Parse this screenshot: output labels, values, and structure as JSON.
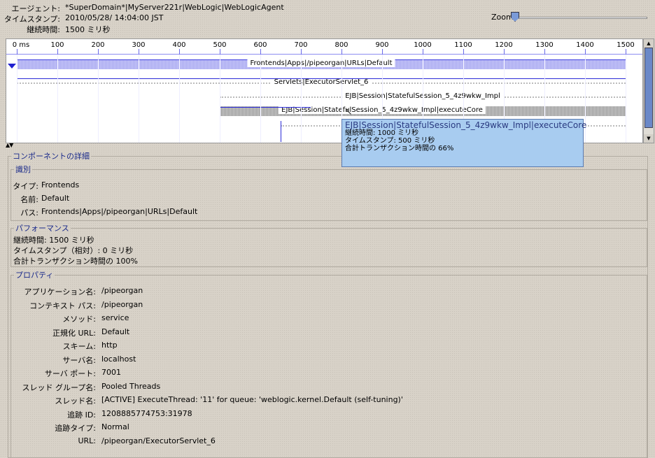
{
  "header": {
    "agent_label": "エージェント:",
    "agent": "*SuperDomain*|MyServer221r|WebLogic|WebLogicAgent",
    "timestamp_label": "タイムスタンプ:",
    "timestamp": "2010/05/28/ 14:04:00 JST",
    "duration_label": "継続時間:",
    "duration": "1500 ミリ秒",
    "zoom_label": "Zoom",
    "zoom_value": 0
  },
  "timeline": {
    "ticks": [
      "0 ms",
      "100",
      "200",
      "300",
      "400",
      "500",
      "600",
      "700",
      "800",
      "900",
      "1000",
      "1100",
      "1200",
      "1300",
      "1400",
      "1500"
    ],
    "rows": [
      {
        "label": "Frontends|Apps|/pipeorgan|URLs|Default",
        "start": 0,
        "duration": 1500
      },
      {
        "label": "Servlets|ExecutorServlet_6",
        "start": 0,
        "duration": 1500
      },
      {
        "label": "EJB|Session|StatefulSession_5_4z9wkw_Impl",
        "start": 500,
        "duration": 1000
      },
      {
        "label": "EJB|Session|StatefulSession_5_4z9wkw_Impl|executeCore",
        "start": 500,
        "duration": 1000
      },
      {
        "label": "EJB|Session|StatefulSession_5_4z9wkw_Impl",
        "start": 650,
        "duration": 850
      }
    ]
  },
  "tooltip": {
    "title": "EJB|Session|StatefulSession_5_4z9wkw_Impl|executeCore",
    "line1": "継続時間: 1000 ミリ秒",
    "line2": "タイムスタンプ: 500 ミリ秒",
    "line3": "合計トランザクション時間の 66%"
  },
  "details": {
    "title": "コンポーネントの詳細",
    "identity": {
      "title": "識別",
      "type_label": "タイプ:",
      "type": "Frontends",
      "name_label": "名前:",
      "name": "Default",
      "path_label": "パス:",
      "path": "Frontends|Apps|/pipeorgan|URLs|Default"
    },
    "performance": {
      "title": "パフォーマンス",
      "line1": "継続時間: 1500 ミリ秒",
      "line2": "タイムスタンプ（相対）: 0 ミリ秒",
      "line3": "合計トランザクション時間の 100%"
    },
    "properties": {
      "title": "プロパティ",
      "items": [
        {
          "label": "アプリケーション名:",
          "value": "/pipeorgan"
        },
        {
          "label": "コンテキスト パス:",
          "value": "/pipeorgan"
        },
        {
          "label": "メソッド:",
          "value": "service"
        },
        {
          "label": "正規化 URL:",
          "value": "Default"
        },
        {
          "label": "スキーム:",
          "value": "http"
        },
        {
          "label": "サーバ名:",
          "value": "localhost"
        },
        {
          "label": "サーバ ポート:",
          "value": "7001"
        },
        {
          "label": "スレッド グループ名:",
          "value": "Pooled Threads"
        },
        {
          "label": "スレッド名:",
          "value": "[ACTIVE] ExecuteThread: '11' for queue: 'weblogic.kernel.Default (self-tuning)'"
        },
        {
          "label": "追跡 ID:",
          "value": "1208885774753:31978"
        },
        {
          "label": "追跡タイプ:",
          "value": "Normal"
        },
        {
          "label": "URL:",
          "value": "/pipeorgan/ExecutorServlet_6"
        }
      ]
    }
  }
}
